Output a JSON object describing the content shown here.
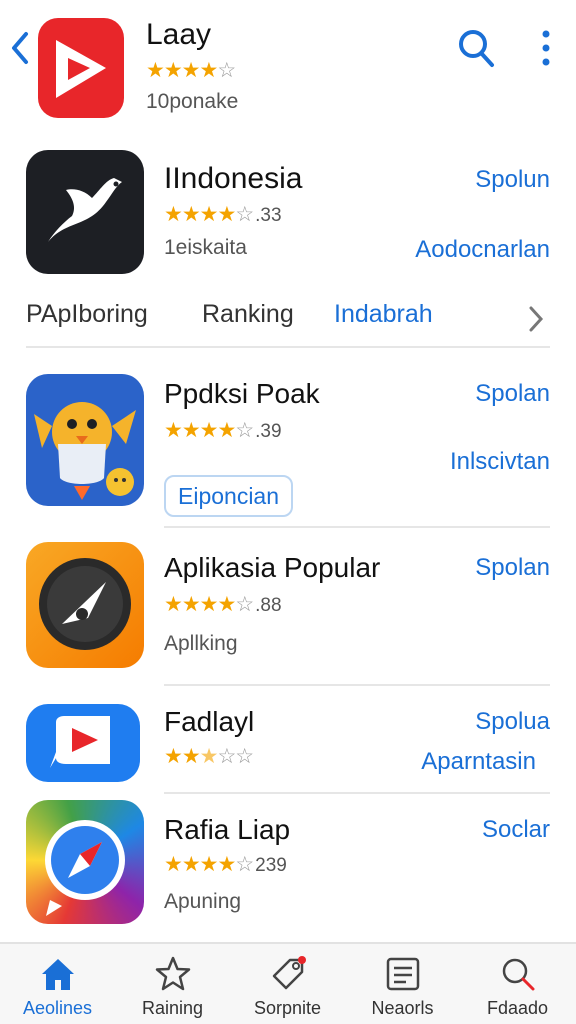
{
  "header": {
    "title": "Laay",
    "rating_stars": 4,
    "subtitle": "10ponake",
    "icons": [
      "back-chevron-icon",
      "play-logo-icon",
      "search-icon",
      "more-vertical-icon"
    ]
  },
  "apps": [
    {
      "name": "IIndonesia",
      "stars": 4,
      "rating": ".33",
      "sub": "1eiskaita",
      "action": "Spolun",
      "action2": "Aodocnarlan",
      "icon": "bird-logo-icon"
    },
    {
      "name": "Ppdksi Poak",
      "stars": 4,
      "rating": ".39",
      "sub": "",
      "action": "Spolan",
      "action2": "Inlscivtan",
      "chip": "Eiponcian",
      "icon": "penguin-rocket-icon"
    },
    {
      "name": "Aplikasia Popular",
      "stars": 4,
      "rating": ".88",
      "sub": "Apllking",
      "action": "Spolan",
      "icon": "compass-dial-icon"
    },
    {
      "name": "Fadlayl",
      "stars": 2.5,
      "rating": "",
      "sub": "",
      "action": "Spolua",
      "action2": "Aparntasin",
      "icon": "play-bubble-icon"
    },
    {
      "name": "Rafia Liap",
      "stars": 4,
      "rating": "239",
      "sub": "Apuning",
      "action": "Soclar",
      "icon": "safari-compass-icon"
    }
  ],
  "tabs": [
    {
      "label": "PApIboring"
    },
    {
      "label": "Ranking"
    },
    {
      "label": "Indabrah"
    }
  ],
  "bottom_nav": [
    {
      "label": "Aeolines",
      "icon": "home-icon"
    },
    {
      "label": "Raining",
      "icon": "star-icon"
    },
    {
      "label": "Sorpnite",
      "icon": "tag-icon"
    },
    {
      "label": "Neaorls",
      "icon": "news-icon"
    },
    {
      "label": "Fdaado",
      "icon": "search-icon"
    }
  ],
  "colors": {
    "accent": "#1a6fd6",
    "star": "#f4a300",
    "header_icon_red": "#e8262a"
  }
}
